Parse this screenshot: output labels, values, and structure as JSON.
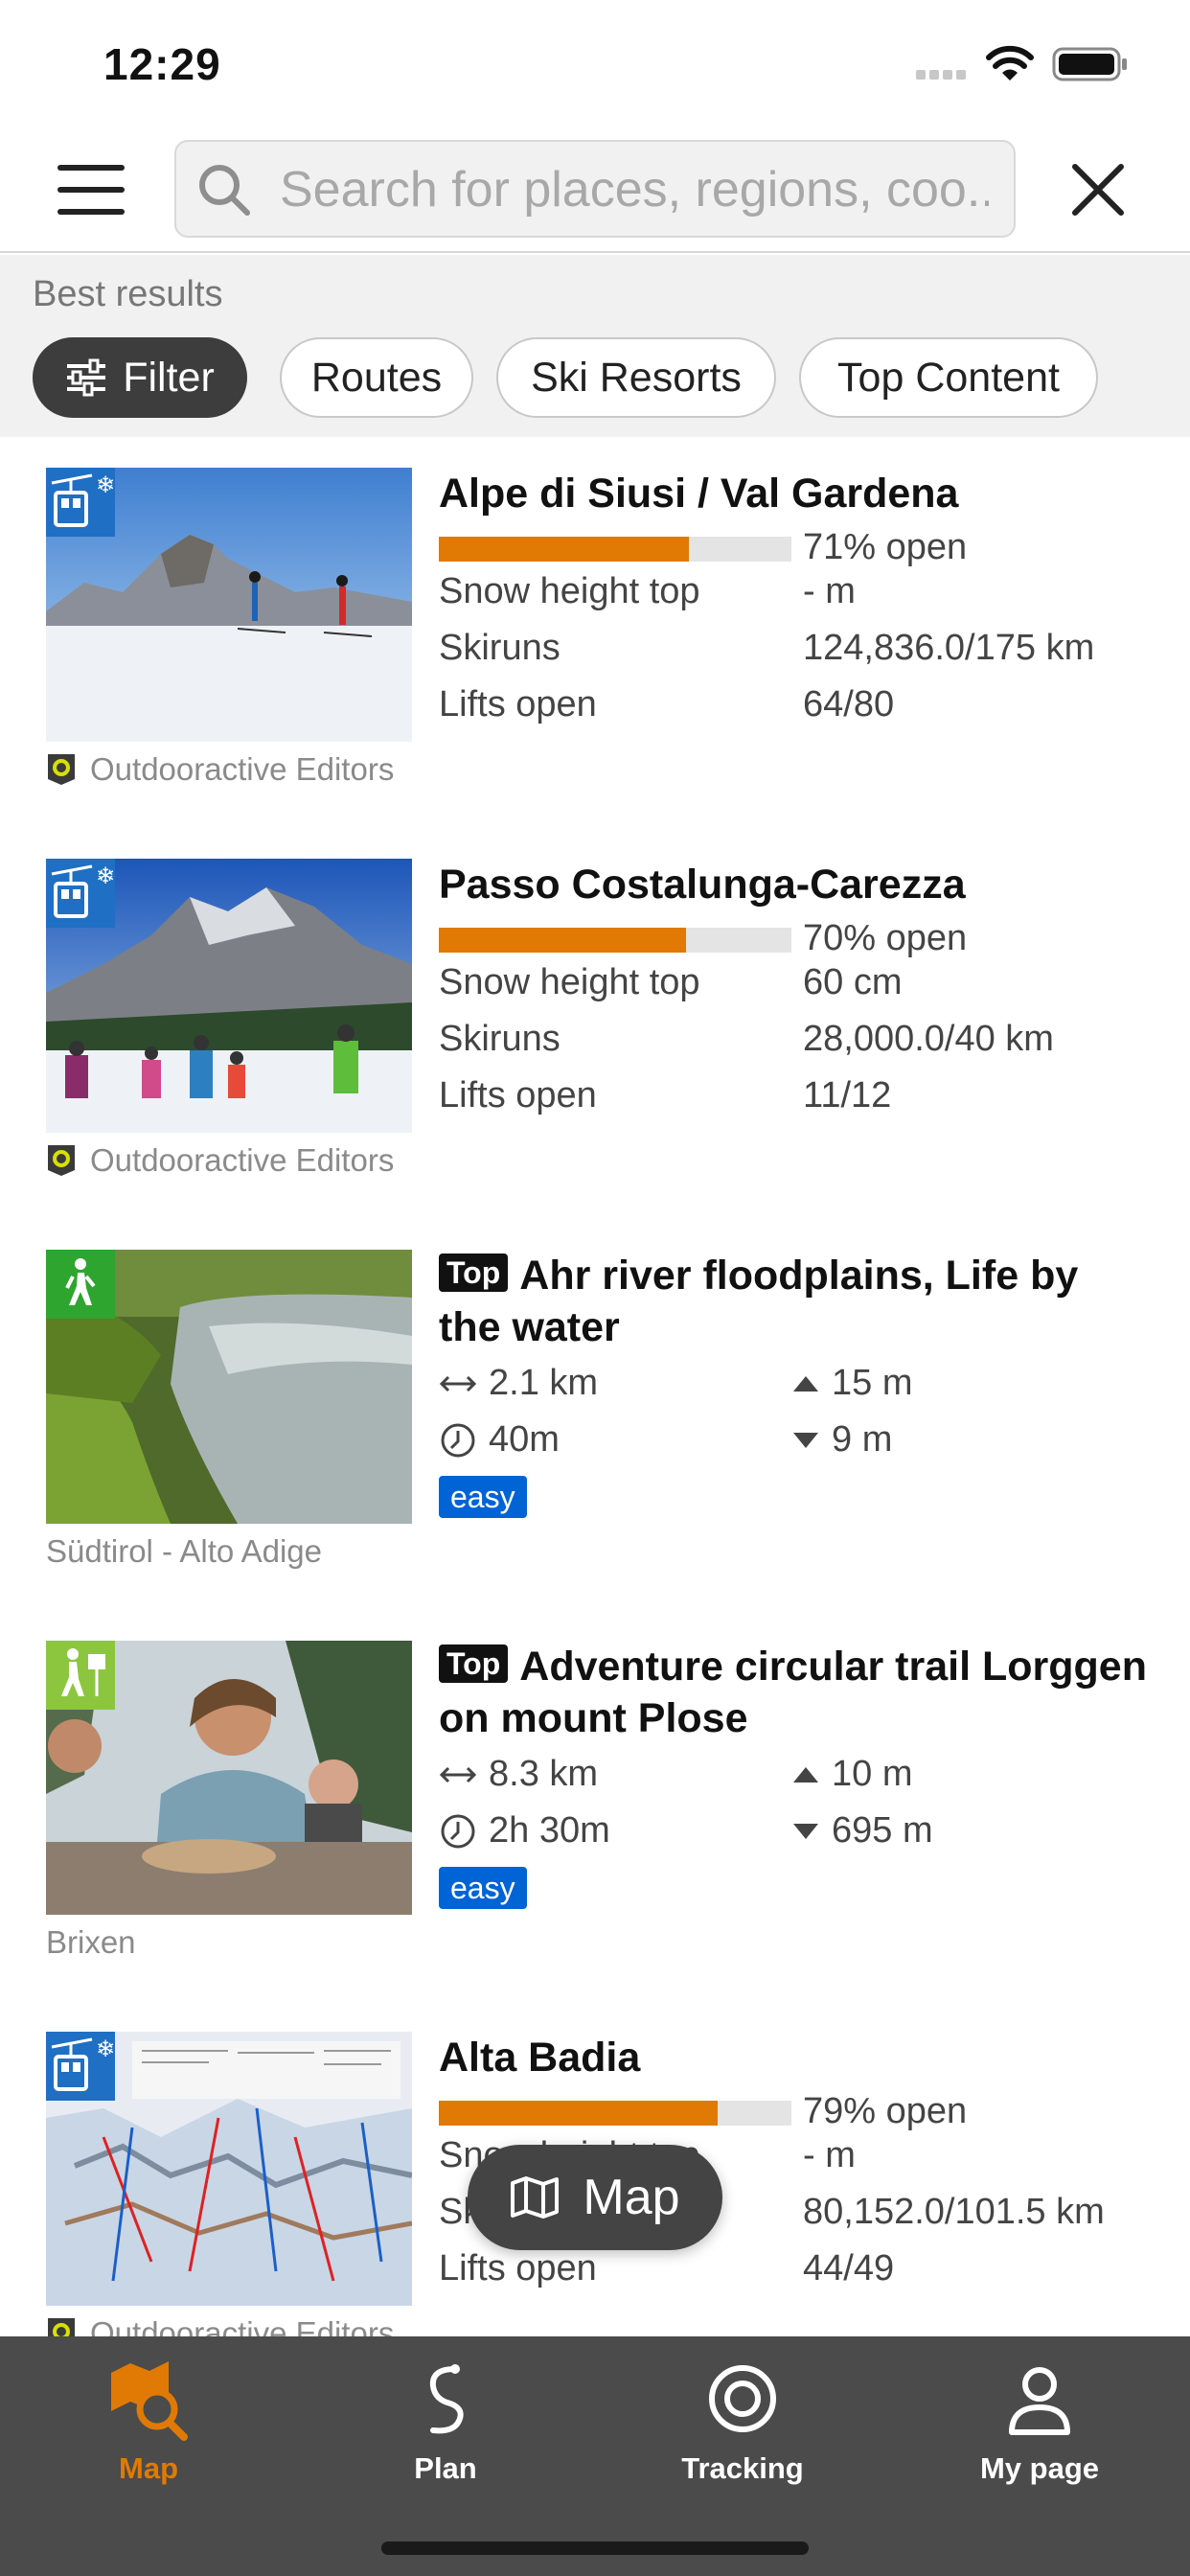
{
  "status_bar": {
    "time": "12:29"
  },
  "search": {
    "placeholder": "Search for places, regions, coo..."
  },
  "filters": {
    "section_label": "Best results",
    "chips": [
      "Filter",
      "Routes",
      "Ski Resorts",
      "Top Content"
    ]
  },
  "results": [
    {
      "type": "ski-resort",
      "title": "Alpe di Siusi / Val Gardena",
      "open_fraction": 0.71,
      "open_text": "71% open",
      "stats": [
        {
          "label": "Snow height top",
          "value": "- m"
        },
        {
          "label": "Skiruns",
          "value": "124,836.0/175 km"
        },
        {
          "label": "Lifts open",
          "value": "64/80"
        }
      ],
      "credit": "Outdooractive Editors",
      "category_icon": "ski-lift-icon"
    },
    {
      "type": "ski-resort",
      "title": "Passo Costalunga-Carezza",
      "open_fraction": 0.7,
      "open_text": "70% open",
      "stats": [
        {
          "label": "Snow height top",
          "value": "60 cm"
        },
        {
          "label": "Skiruns",
          "value": "28,000.0/40 km"
        },
        {
          "label": "Lifts open",
          "value": "11/12"
        }
      ],
      "credit": "Outdooractive Editors",
      "category_icon": "ski-lift-icon"
    },
    {
      "type": "route",
      "tag": "Top",
      "title": "Ahr river floodplains, Life by the water",
      "distance": "2.1 km",
      "duration": "40m",
      "ascent": "15 m",
      "descent": "9 m",
      "difficulty": "easy",
      "credit": "Südtirol - Alto Adige",
      "category_icon": "hiking-icon"
    },
    {
      "type": "route",
      "tag": "Top",
      "title": "Adventure circular trail Lorggen on mount Plose",
      "distance": "8.3 km",
      "duration": "2h 30m",
      "ascent": "10 m",
      "descent": "695 m",
      "difficulty": "easy",
      "credit": "Brixen",
      "category_icon": "family-hike-icon"
    },
    {
      "type": "ski-resort",
      "title": "Alta Badia",
      "open_fraction": 0.79,
      "open_text": "79% open",
      "stats": [
        {
          "label": "Snow height top",
          "value": "- m"
        },
        {
          "label": "Skiruns",
          "value": "80,152.0/101.5 km"
        },
        {
          "label": "Lifts open",
          "value": "44/49"
        }
      ],
      "credit": "Outdooractive Editors",
      "category_icon": "ski-lift-icon"
    }
  ],
  "map_button": {
    "label": "Map"
  },
  "tab_bar": {
    "active": "Map",
    "tabs": [
      "Map",
      "Plan",
      "Tracking",
      "My page"
    ]
  },
  "colors": {
    "accent": "#e07a05",
    "difficulty_easy": "#0063d6",
    "ski_badge": "#1f6fc4",
    "hike_badge": "#2ea52e",
    "family_badge": "#8cc63f"
  }
}
